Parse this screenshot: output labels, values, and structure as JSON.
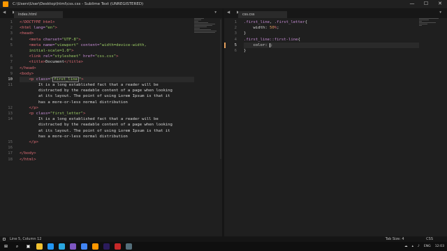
{
  "window": {
    "title": "C:\\Users\\User\\Desktop\\html\\css.css - Sublime Text (UNREGISTERED)",
    "controls": [
      "—",
      "☐",
      "✕"
    ]
  },
  "left_pane": {
    "tab_label": "index.html",
    "line_numbers": [
      "1",
      "2",
      "3",
      "4",
      "5",
      "6",
      "7",
      "8",
      "9",
      "10",
      "11",
      "12",
      "13",
      "14",
      "15",
      "16",
      "17",
      "18"
    ],
    "current_line": "10",
    "lines": {
      "l1": "<!DOCTYPE html>",
      "l2_tag": "<html",
      "l2_attr": " lang=",
      "l2_val": "\"en\"",
      "l2_end": ">",
      "l3": "<head>",
      "l4_tag": "<meta",
      "l4_attr": " charset=",
      "l4_val": "\"UTF-8\"",
      "l4_end": ">",
      "l5_tag": "<meta",
      "l5_attr": " name=",
      "l5_val": "\"viewport\"",
      "l5_attr2": " content=",
      "l5_val2": "\"width=device-width,",
      "l5_cont": "initial-scale=1.0\"",
      "l5_end": ">",
      "l6_tag": "<link",
      "l6_attr": " rel=",
      "l6_val": "\"stylesheet\"",
      "l6_attr2": " href=",
      "l6_val2": "\"css.css\"",
      "l6_end": ">",
      "l7_open": "<title>",
      "l7_text": "Document",
      "l7_close": "</title>",
      "l8": "</head>",
      "l9": "<body>",
      "l10_tag": "<p",
      "l10_attr": " class=",
      "l10_q1": "\"",
      "l10_val": "first_line",
      "l10_q2": "\"",
      "l10_end": ">",
      "l11_a": "It is a long established fact that a reader will be",
      "l11_b": "distracted by the readable content of a page when looking",
      "l11_c": "at its layout. The point of using Lorem Ipsum is that it",
      "l11_d": "has a more-or-less normal distribution",
      "l12": "</p>",
      "l13_tag": "<p",
      "l13_attr": " class=",
      "l13_val": "\"first_letter\"",
      "l13_end": ">",
      "l14_a": "It is a long established fact that a reader will be",
      "l14_b": "distracted by the readable content of a page when looking",
      "l14_c": "at its layout. The point of using Lorem Ipsum is that it",
      "l14_d": "has a more-or-less normal distribution",
      "l15": "</p>",
      "l17": "</body>",
      "l18": "</html>"
    }
  },
  "right_pane": {
    "tab_label": "css.css",
    "line_numbers": [
      "1",
      "2",
      "3",
      "4",
      "5",
      "6"
    ],
    "current_line": "5",
    "lines": {
      "l1_sel1": ".first_line",
      "l1_sep": ", ",
      "l1_sel2": ".first_letter",
      "l1_open": "{",
      "l2_prop": "width",
      "l2_colon": ": ",
      "l2_num": "50",
      "l2_unit": "%",
      "l2_semi": ";",
      "l3": "}",
      "l4_sel": ".first_line",
      "l4_pseudo": "::first-line",
      "l4_open": "{",
      "l5_prop": "color",
      "l5_colon": ": ",
      "l5_semi": ";",
      "l6": "}"
    }
  },
  "status": {
    "position": "Line 5, Column 12",
    "tab_size": "Tab Size: 4",
    "syntax": "CSS"
  },
  "taskbar": {
    "language": "ENG",
    "time": "12:03"
  },
  "colors": {
    "accent": "#ff9800",
    "tag": "#e06c75",
    "string": "#9ccc65",
    "attribute": "#c78dd6"
  }
}
